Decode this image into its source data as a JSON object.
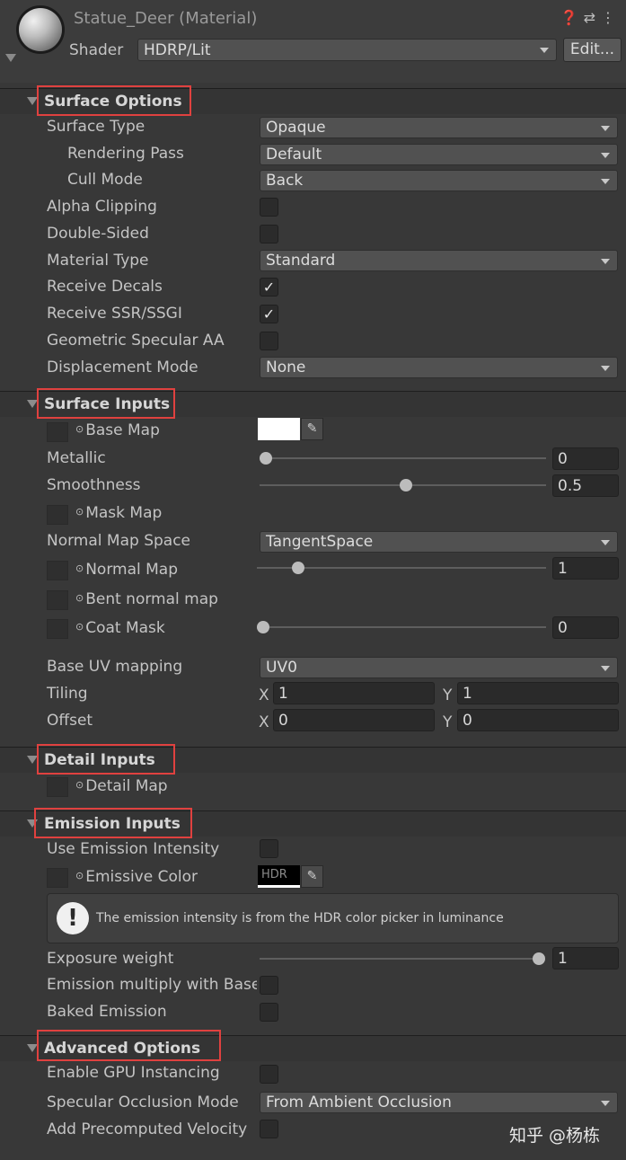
{
  "header": {
    "title": "Statue_Deer (Material)",
    "icons": [
      "help-icon",
      "settings-sliders-icon",
      "more-icon"
    ],
    "shader_label": "Shader",
    "shader_value": "HDRP/Lit",
    "edit_label": "Edit..."
  },
  "surface_options": {
    "title": "Surface Options",
    "surface_type": {
      "label": "Surface Type",
      "value": "Opaque"
    },
    "rendering_pass": {
      "label": "Rendering Pass",
      "value": "Default"
    },
    "cull_mode": {
      "label": "Cull Mode",
      "value": "Back"
    },
    "alpha_clipping": {
      "label": "Alpha Clipping",
      "checked": false
    },
    "double_sided": {
      "label": "Double-Sided",
      "checked": false
    },
    "material_type": {
      "label": "Material Type",
      "value": "Standard"
    },
    "receive_decals": {
      "label": "Receive Decals",
      "checked": true
    },
    "receive_ssr": {
      "label": "Receive SSR/SSGI",
      "checked": true
    },
    "geometric_specular_aa": {
      "label": "Geometric Specular AA",
      "checked": false
    },
    "displacement_mode": {
      "label": "Displacement Mode",
      "value": "None"
    }
  },
  "surface_inputs": {
    "title": "Surface Inputs",
    "base_map": {
      "label": "Base Map",
      "color": "#ffffff"
    },
    "metallic": {
      "label": "Metallic",
      "value": "0",
      "fraction": 0.0
    },
    "smoothness": {
      "label": "Smoothness",
      "value": "0.5",
      "fraction": 0.5
    },
    "mask_map": {
      "label": "Mask Map"
    },
    "normal_map_space": {
      "label": "Normal Map Space",
      "value": "TangentSpace"
    },
    "normal_map": {
      "label": "Normal Map",
      "value": "1",
      "fraction": 0.125
    },
    "bent_normal_map": {
      "label": "Bent normal map"
    },
    "coat_mask": {
      "label": "Coat Mask",
      "value": "0",
      "fraction": 0.0
    },
    "base_uv_mapping": {
      "label": "Base UV mapping",
      "value": "UV0"
    },
    "tiling": {
      "label": "Tiling",
      "x_label": "X",
      "x": "1",
      "y_label": "Y",
      "y": "1"
    },
    "offset": {
      "label": "Offset",
      "x_label": "X",
      "x": "0",
      "y_label": "Y",
      "y": "0"
    }
  },
  "detail_inputs": {
    "title": "Detail Inputs",
    "detail_map": {
      "label": "Detail Map"
    }
  },
  "emission_inputs": {
    "title": "Emission Inputs",
    "use_emission_intensity": {
      "label": "Use Emission Intensity",
      "checked": false
    },
    "emissive_color": {
      "label": "Emissive Color",
      "hdr_label": "HDR",
      "color": "#000000"
    },
    "help_text": "The emission intensity is from the HDR color picker in luminance",
    "exposure_weight": {
      "label": "Exposure weight",
      "value": "1",
      "fraction": 1.0
    },
    "emission_multiply": {
      "label": "Emission multiply with Base",
      "checked": false
    },
    "baked_emission": {
      "label": "Baked Emission",
      "checked": false
    }
  },
  "advanced_options": {
    "title": "Advanced Options",
    "gpu_instancing": {
      "label": "Enable GPU Instancing",
      "checked": false
    },
    "specular_occlusion_mode": {
      "label": "Specular Occlusion Mode",
      "value": "From Ambient Occlusion"
    },
    "precomputed_velocity": {
      "label": "Add Precomputed Velocity",
      "checked": false
    }
  },
  "watermark": "知乎 @杨栋",
  "colors": {
    "background": "#383838",
    "highlight_box": "#e0413f"
  }
}
